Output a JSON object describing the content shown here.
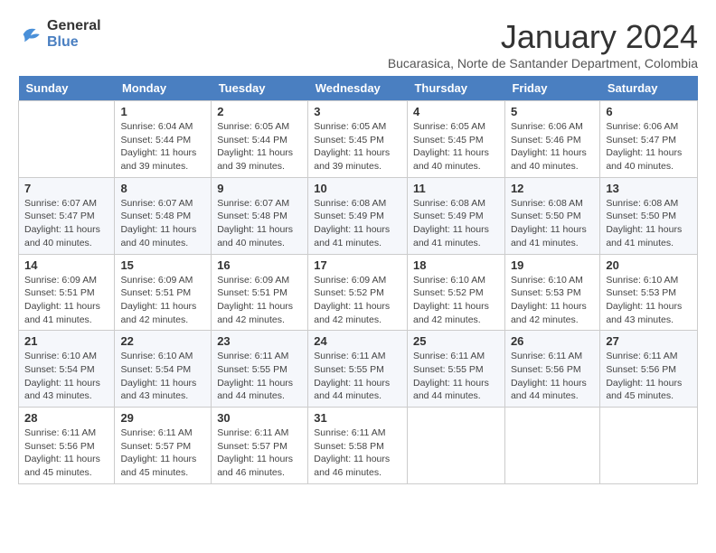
{
  "logo": {
    "line1": "General",
    "line2": "Blue"
  },
  "title": "January 2024",
  "subtitle": "Bucarasica, Norte de Santander Department, Colombia",
  "days_of_week": [
    "Sunday",
    "Monday",
    "Tuesday",
    "Wednesday",
    "Thursday",
    "Friday",
    "Saturday"
  ],
  "weeks": [
    [
      {
        "day": "",
        "info": ""
      },
      {
        "day": "1",
        "info": "Sunrise: 6:04 AM\nSunset: 5:44 PM\nDaylight: 11 hours\nand 39 minutes."
      },
      {
        "day": "2",
        "info": "Sunrise: 6:05 AM\nSunset: 5:44 PM\nDaylight: 11 hours\nand 39 minutes."
      },
      {
        "day": "3",
        "info": "Sunrise: 6:05 AM\nSunset: 5:45 PM\nDaylight: 11 hours\nand 39 minutes."
      },
      {
        "day": "4",
        "info": "Sunrise: 6:05 AM\nSunset: 5:45 PM\nDaylight: 11 hours\nand 40 minutes."
      },
      {
        "day": "5",
        "info": "Sunrise: 6:06 AM\nSunset: 5:46 PM\nDaylight: 11 hours\nand 40 minutes."
      },
      {
        "day": "6",
        "info": "Sunrise: 6:06 AM\nSunset: 5:47 PM\nDaylight: 11 hours\nand 40 minutes."
      }
    ],
    [
      {
        "day": "7",
        "info": "Sunrise: 6:07 AM\nSunset: 5:47 PM\nDaylight: 11 hours\nand 40 minutes."
      },
      {
        "day": "8",
        "info": "Sunrise: 6:07 AM\nSunset: 5:48 PM\nDaylight: 11 hours\nand 40 minutes."
      },
      {
        "day": "9",
        "info": "Sunrise: 6:07 AM\nSunset: 5:48 PM\nDaylight: 11 hours\nand 40 minutes."
      },
      {
        "day": "10",
        "info": "Sunrise: 6:08 AM\nSunset: 5:49 PM\nDaylight: 11 hours\nand 41 minutes."
      },
      {
        "day": "11",
        "info": "Sunrise: 6:08 AM\nSunset: 5:49 PM\nDaylight: 11 hours\nand 41 minutes."
      },
      {
        "day": "12",
        "info": "Sunrise: 6:08 AM\nSunset: 5:50 PM\nDaylight: 11 hours\nand 41 minutes."
      },
      {
        "day": "13",
        "info": "Sunrise: 6:08 AM\nSunset: 5:50 PM\nDaylight: 11 hours\nand 41 minutes."
      }
    ],
    [
      {
        "day": "14",
        "info": "Sunrise: 6:09 AM\nSunset: 5:51 PM\nDaylight: 11 hours\nand 41 minutes."
      },
      {
        "day": "15",
        "info": "Sunrise: 6:09 AM\nSunset: 5:51 PM\nDaylight: 11 hours\nand 42 minutes."
      },
      {
        "day": "16",
        "info": "Sunrise: 6:09 AM\nSunset: 5:51 PM\nDaylight: 11 hours\nand 42 minutes."
      },
      {
        "day": "17",
        "info": "Sunrise: 6:09 AM\nSunset: 5:52 PM\nDaylight: 11 hours\nand 42 minutes."
      },
      {
        "day": "18",
        "info": "Sunrise: 6:10 AM\nSunset: 5:52 PM\nDaylight: 11 hours\nand 42 minutes."
      },
      {
        "day": "19",
        "info": "Sunrise: 6:10 AM\nSunset: 5:53 PM\nDaylight: 11 hours\nand 42 minutes."
      },
      {
        "day": "20",
        "info": "Sunrise: 6:10 AM\nSunset: 5:53 PM\nDaylight: 11 hours\nand 43 minutes."
      }
    ],
    [
      {
        "day": "21",
        "info": "Sunrise: 6:10 AM\nSunset: 5:54 PM\nDaylight: 11 hours\nand 43 minutes."
      },
      {
        "day": "22",
        "info": "Sunrise: 6:10 AM\nSunset: 5:54 PM\nDaylight: 11 hours\nand 43 minutes."
      },
      {
        "day": "23",
        "info": "Sunrise: 6:11 AM\nSunset: 5:55 PM\nDaylight: 11 hours\nand 44 minutes."
      },
      {
        "day": "24",
        "info": "Sunrise: 6:11 AM\nSunset: 5:55 PM\nDaylight: 11 hours\nand 44 minutes."
      },
      {
        "day": "25",
        "info": "Sunrise: 6:11 AM\nSunset: 5:55 PM\nDaylight: 11 hours\nand 44 minutes."
      },
      {
        "day": "26",
        "info": "Sunrise: 6:11 AM\nSunset: 5:56 PM\nDaylight: 11 hours\nand 44 minutes."
      },
      {
        "day": "27",
        "info": "Sunrise: 6:11 AM\nSunset: 5:56 PM\nDaylight: 11 hours\nand 45 minutes."
      }
    ],
    [
      {
        "day": "28",
        "info": "Sunrise: 6:11 AM\nSunset: 5:56 PM\nDaylight: 11 hours\nand 45 minutes."
      },
      {
        "day": "29",
        "info": "Sunrise: 6:11 AM\nSunset: 5:57 PM\nDaylight: 11 hours\nand 45 minutes."
      },
      {
        "day": "30",
        "info": "Sunrise: 6:11 AM\nSunset: 5:57 PM\nDaylight: 11 hours\nand 46 minutes."
      },
      {
        "day": "31",
        "info": "Sunrise: 6:11 AM\nSunset: 5:58 PM\nDaylight: 11 hours\nand 46 minutes."
      },
      {
        "day": "",
        "info": ""
      },
      {
        "day": "",
        "info": ""
      },
      {
        "day": "",
        "info": ""
      }
    ]
  ]
}
